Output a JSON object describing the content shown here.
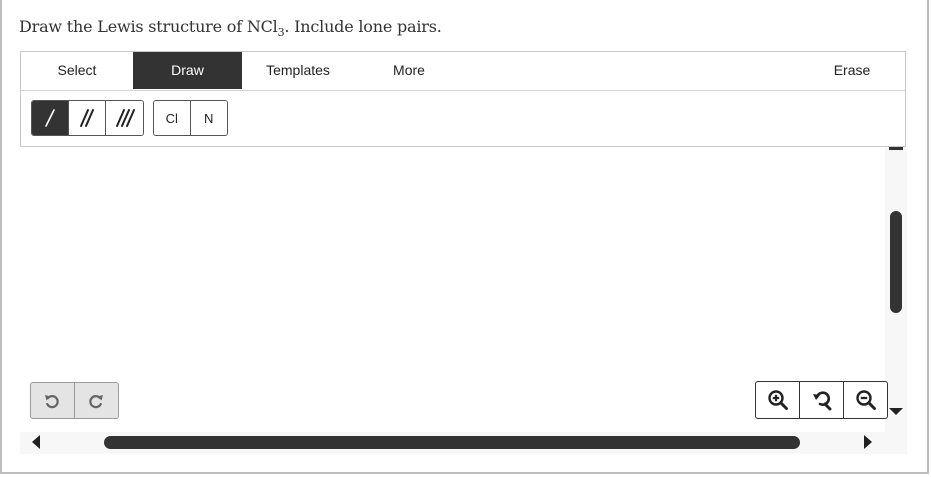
{
  "question": {
    "prefix": "Draw the Lewis structure of NCl",
    "subscript": "3",
    "suffix": ". Include lone pairs."
  },
  "tabs": [
    {
      "label": "Select",
      "active": false
    },
    {
      "label": "Draw",
      "active": true
    },
    {
      "label": "Templates",
      "active": false
    },
    {
      "label": "More",
      "active": false
    },
    {
      "label": "Erase",
      "active": false
    }
  ],
  "bond_tools": [
    {
      "name": "single-bond-icon",
      "selected": true
    },
    {
      "name": "double-bond-icon",
      "selected": false
    },
    {
      "name": "triple-bond-icon",
      "selected": false
    }
  ],
  "atoms": [
    "Cl",
    "N"
  ],
  "history": {
    "undo_icon": "undo-icon",
    "redo_icon": "redo-icon"
  },
  "zoom": {
    "in_icon": "zoom-in-icon",
    "reset_icon": "zoom-reset-icon",
    "out_icon": "zoom-out-icon"
  },
  "colors": {
    "accent": "#333333",
    "disabled_bg": "#e4e4e4",
    "scroll_track": "#f7f7f7"
  }
}
